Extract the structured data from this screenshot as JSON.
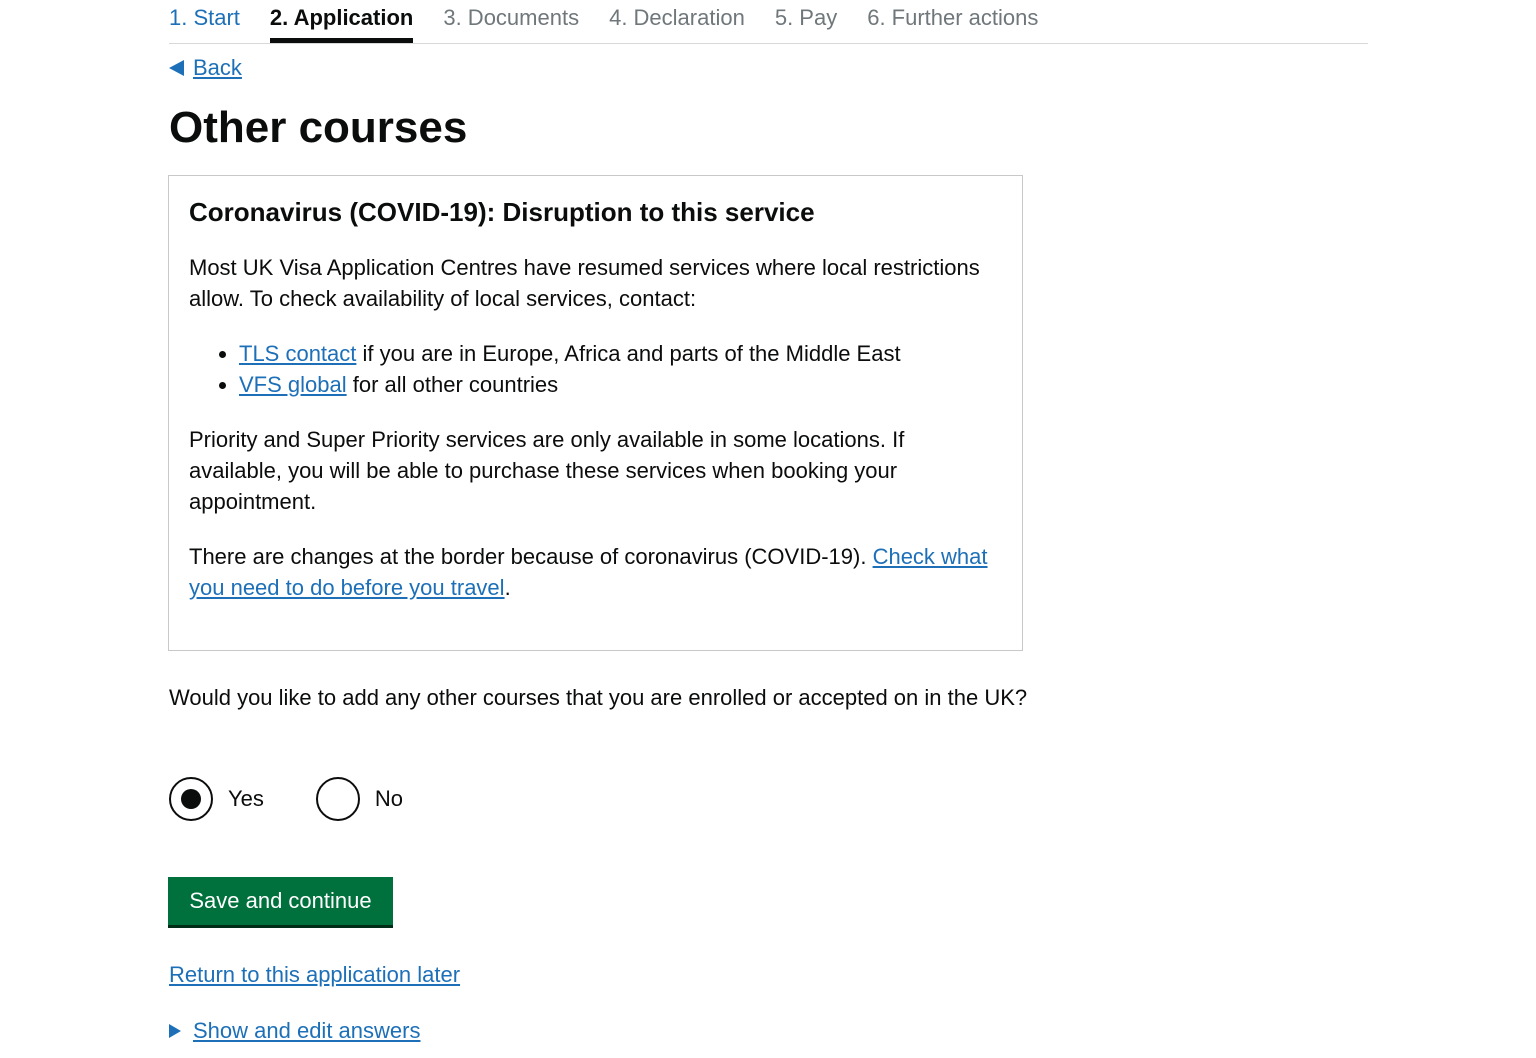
{
  "steps": [
    {
      "label": "1. Start"
    },
    {
      "label": "2. Application"
    },
    {
      "label": "3. Documents"
    },
    {
      "label": "4. Declaration"
    },
    {
      "label": "5. Pay"
    },
    {
      "label": "6. Further actions"
    }
  ],
  "back_label": "Back",
  "page_title": "Other courses",
  "notice": {
    "heading": "Coronavirus (COVID-19): Disruption to this service",
    "para1": "Most UK Visa Application Centres have resumed services where local restrictions allow. To check availability of local services, contact:",
    "bullets": [
      {
        "link": "TLS contact",
        "rest": " if you are in Europe, Africa and parts of the Middle East"
      },
      {
        "link": "VFS global",
        "rest": " for all other countries"
      }
    ],
    "para2": "Priority and Super Priority services are only available in some locations. If available, you will be able to purchase these services when booking your appointment.",
    "para3_text": "There are changes at the border because of coronavirus (COVID-19). ",
    "para3_link": "Check what you need to do before you travel",
    "para3_end": "."
  },
  "question": "Would you like to add any other courses that you are enrolled or accepted on in the UK?",
  "radios": {
    "yes_label": "Yes",
    "no_label": "No",
    "selected": "Yes"
  },
  "save_button": "Save and continue",
  "return_later": "Return to this application later",
  "show_edit": "Show and edit answers",
  "colors": {
    "link": "#1d70b8",
    "button": "#00703c",
    "text": "#0b0c0c",
    "muted": "#6f777b"
  }
}
